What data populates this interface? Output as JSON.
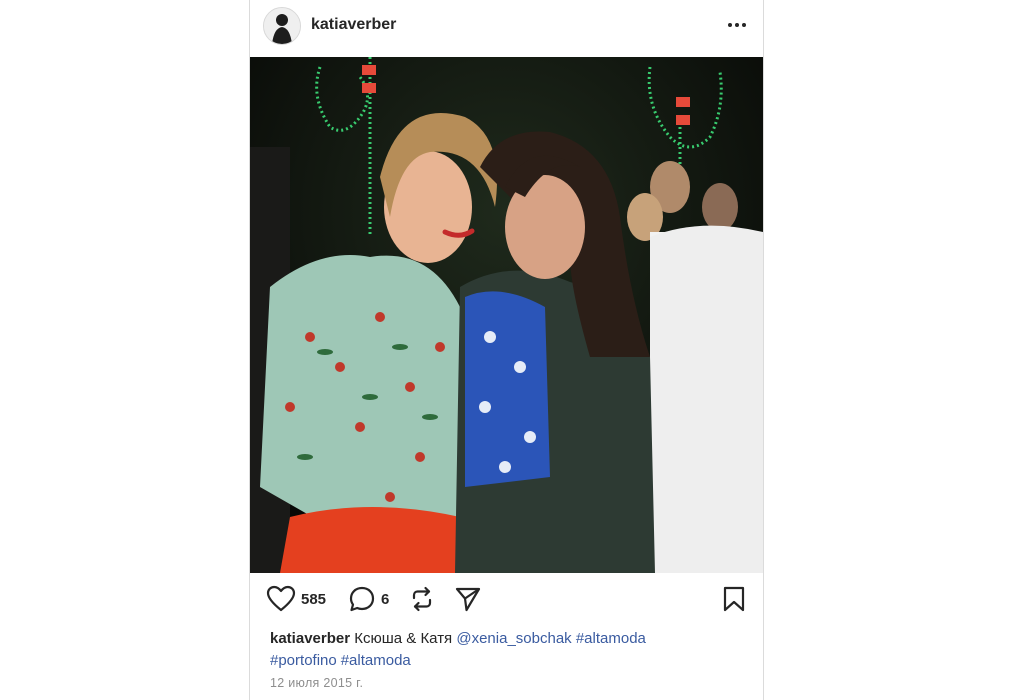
{
  "post": {
    "username": "katiaverber",
    "likes": "585",
    "comments": "6",
    "caption": {
      "user": "katiaverber",
      "text": "Ксюша & Катя",
      "mention": "@xenia_sobchak",
      "tags": [
        "#altamoda",
        "#portofino",
        "#altamoda"
      ]
    },
    "date": "12 июля 2015 г."
  },
  "icons": {
    "more": "more-dots-icon",
    "like": "heart-icon",
    "comment": "comment-icon",
    "repost": "repost-icon",
    "share": "share-icon",
    "save": "bookmark-icon"
  },
  "colors": {
    "text": "#262626",
    "link": "#3a5ba0",
    "muted": "#8e8e8e",
    "border": "#dbdbdb"
  }
}
